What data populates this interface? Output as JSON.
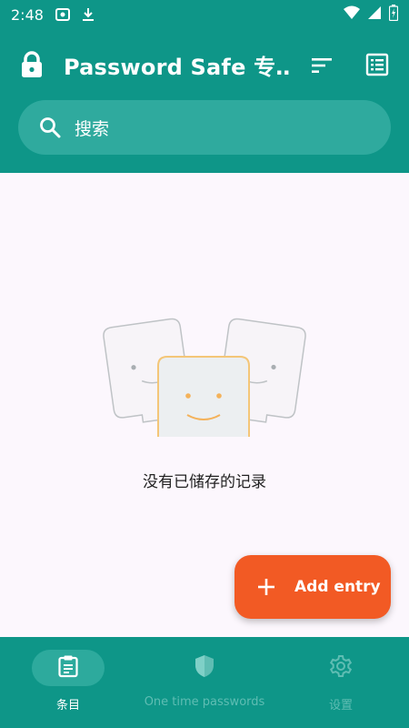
{
  "status_bar": {
    "time": "2:48"
  },
  "app_bar": {
    "title": "Password Safe 专…",
    "icons": [
      "lock-icon",
      "sort-icon",
      "list-view-icon"
    ]
  },
  "search": {
    "placeholder": "搜索"
  },
  "empty_state": {
    "message": "没有已储存的记录"
  },
  "fab": {
    "label": "Add entry",
    "icon": "plus-icon"
  },
  "bottom_nav": {
    "items": [
      {
        "label": "条目",
        "icon": "clipboard-icon",
        "active": true
      },
      {
        "label": "One time passwords",
        "icon": "shield-icon",
        "active": false
      },
      {
        "label": "设置",
        "icon": "gear-icon",
        "active": false
      }
    ]
  },
  "colors": {
    "primary": "#0E9688",
    "search_bg": "#2FAA9E",
    "background": "#FCF7FD",
    "fab": "#F25A24",
    "mascot_outline": "#F4C678",
    "mascot_fill": "#ECEFF1"
  }
}
